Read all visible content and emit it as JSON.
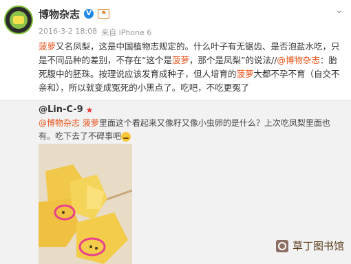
{
  "post": {
    "author": "博物杂志",
    "verified_badge": "V",
    "flag_label": "⚑",
    "date": "2016-3-2 18:08",
    "source": "来自 iPhone 6",
    "text_parts": [
      {
        "t": "菠萝",
        "hl": "orange"
      },
      {
        "t": "又名凤梨，这是中国植物志规定的。什么叶子有无锯齿、是否泡盐水吃，只是不同品种的差别，不存在“这个是",
        "hl": ""
      },
      {
        "t": "菠萝",
        "hl": "orange"
      },
      {
        "t": "，那个是凤梨”的说法//",
        "hl": ""
      },
      {
        "t": "@博物杂志",
        "hl": "link"
      },
      {
        "t": "：胎死腹中的胚珠。按理说应该发育成种子，但人培育的",
        "hl": ""
      },
      {
        "t": "菠萝",
        "hl": "orange"
      },
      {
        "t": "大都不孕不育（自交不亲和），所以就变成冤死的小黑点了。吃吧，不吃更冤了",
        "hl": ""
      }
    ]
  },
  "repost": {
    "user": "@Lin-C-9",
    "user_mark": "★",
    "text_parts": [
      {
        "t": "@博物杂志",
        "hl": "link"
      },
      {
        "t": " ",
        "hl": ""
      },
      {
        "t": "菠萝",
        "hl": "orange"
      },
      {
        "t": "里面这个看起来又像籽又像小虫卵的是什么？上次吃凤梨里面也有。吃下去了不碍事吧",
        "hl": ""
      }
    ]
  },
  "watermark": "草丁图书馆",
  "colors": {
    "accent": "#e8541c",
    "verified": "#1e88e5",
    "repost_bg": "#f2f2f2"
  }
}
